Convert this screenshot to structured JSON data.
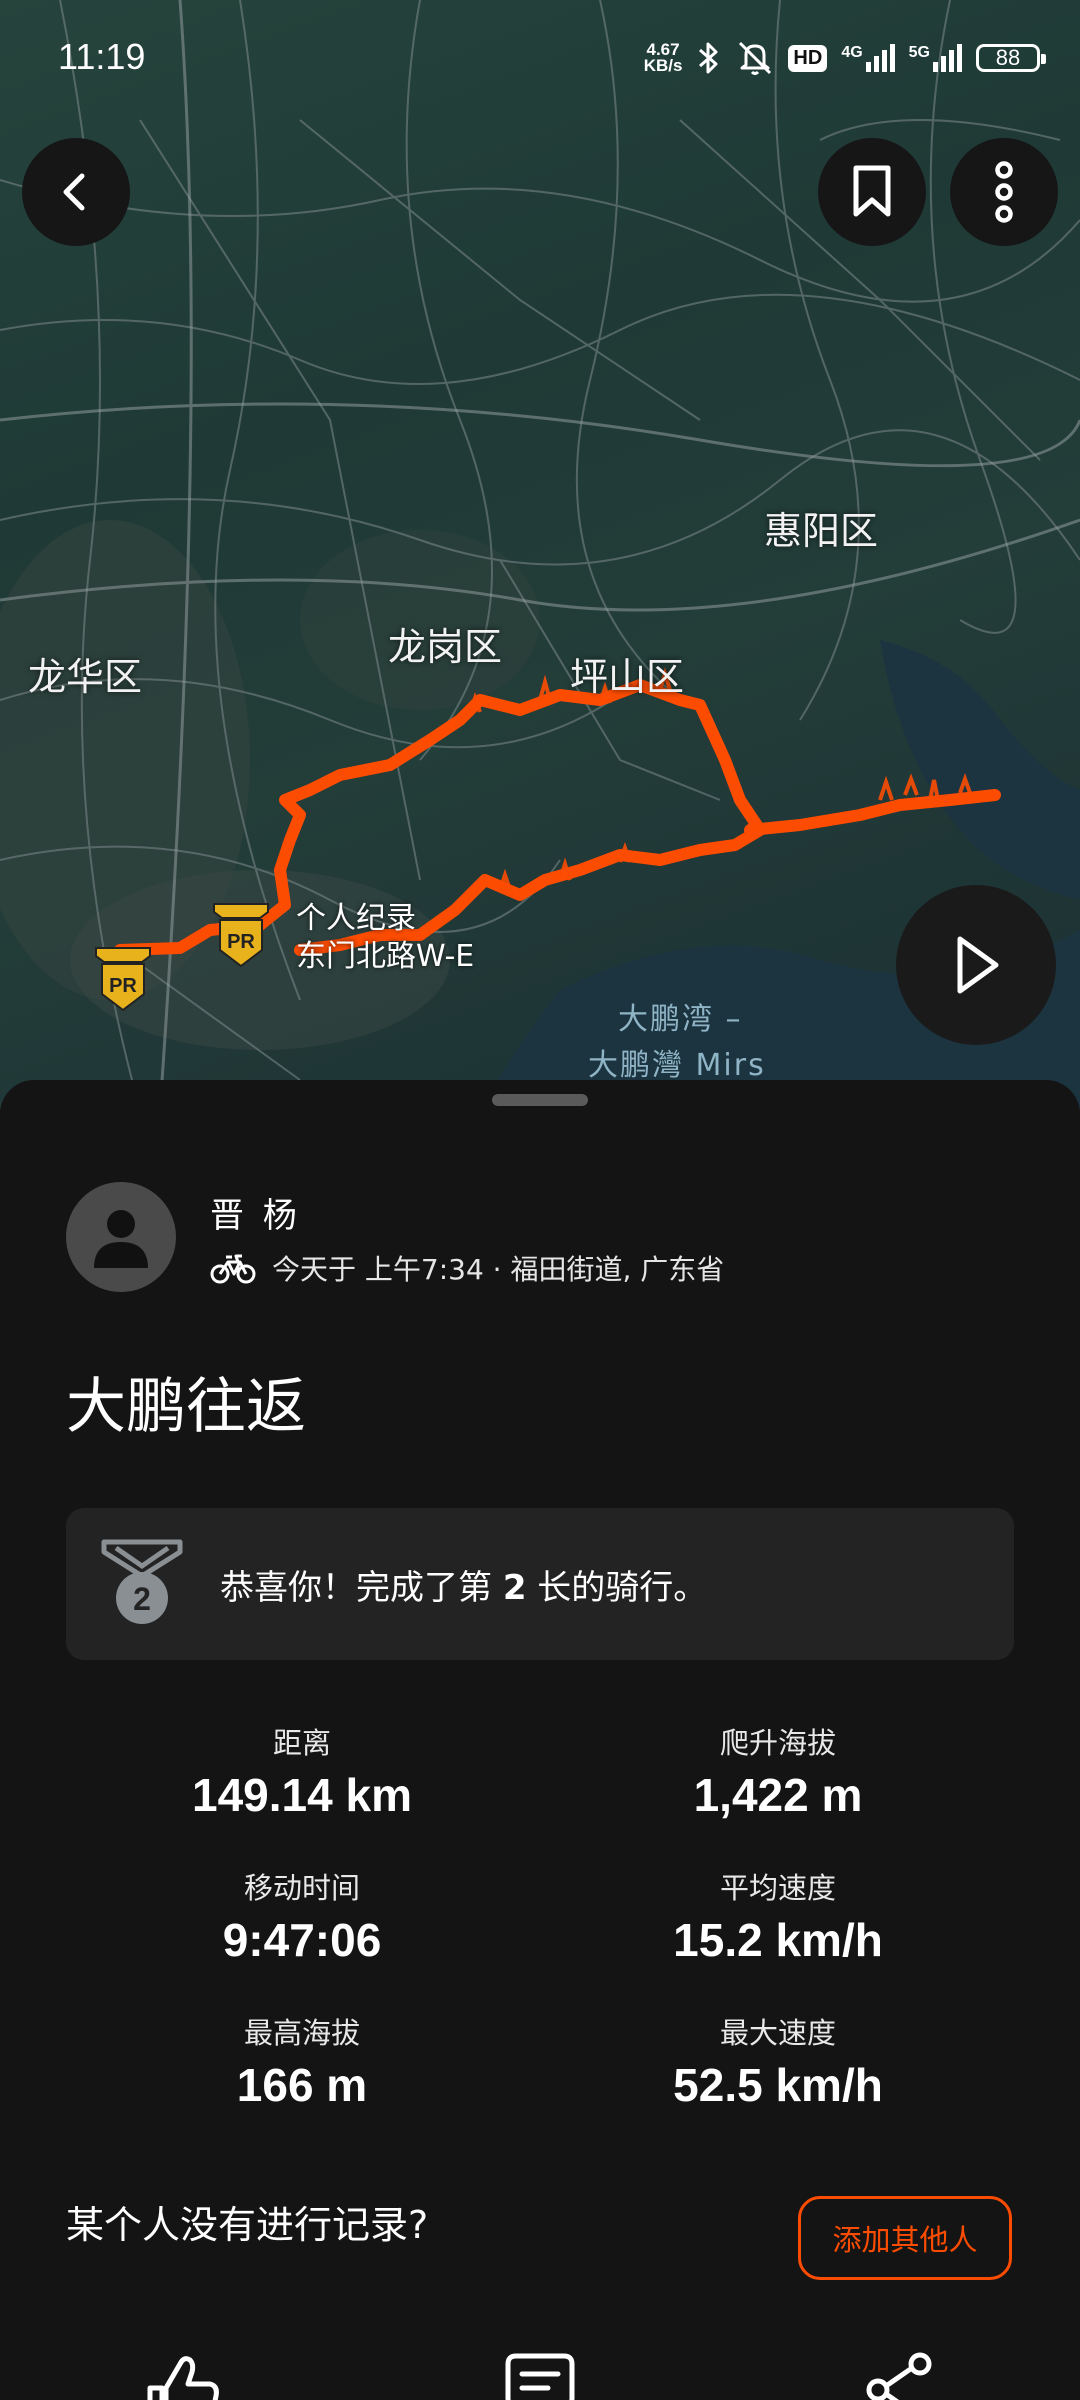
{
  "status_bar": {
    "time": "11:19",
    "net_speed_value": "4.67",
    "net_speed_unit": "KB/s",
    "hd_label": "HD",
    "signal1_label": "4G",
    "signal2_label": "5G",
    "battery": "88",
    "icons": [
      "bluetooth-icon",
      "mute-bell-icon",
      "signal-icon",
      "battery-icon"
    ]
  },
  "map": {
    "place_labels": [
      "惠阳区",
      "龙岗区",
      "坪山区",
      "龙华区"
    ],
    "water_label_1": "大鹏湾 –",
    "water_label_2": "大鹏灣 Mirs",
    "segment_line_1": "个人纪录",
    "segment_line_2": "东门北路W-E",
    "pr_badge_text": "PR",
    "route_color": "#fc4c02",
    "badge_color": "#e8b21c"
  },
  "athlete": {
    "name": "晋 杨",
    "meta": "今天于 上午7:34 · 福田街道, 广东省"
  },
  "activity": {
    "title": "大鹏往返"
  },
  "achievement": {
    "medal_number": "2",
    "text_before": "恭喜你！完成了第 ",
    "rank": "2",
    "text_after": " 长的骑行。"
  },
  "stats": [
    {
      "label": "距离",
      "value": "149.14 km"
    },
    {
      "label": "爬升海拔",
      "value": "1,422 m"
    },
    {
      "label": "移动时间",
      "value": "9:47:06"
    },
    {
      "label": "平均速度",
      "value": "15.2 km/h"
    },
    {
      "label": "最高海拔",
      "value": "166 m"
    },
    {
      "label": "最大速度",
      "value": "52.5 km/h"
    }
  ],
  "others": {
    "prompt": "某个人没有进行记录?",
    "button_label": "添加其他人"
  },
  "colors": {
    "accent": "#fc4c02",
    "sheet_bg": "#141414",
    "card_bg": "#232323"
  }
}
